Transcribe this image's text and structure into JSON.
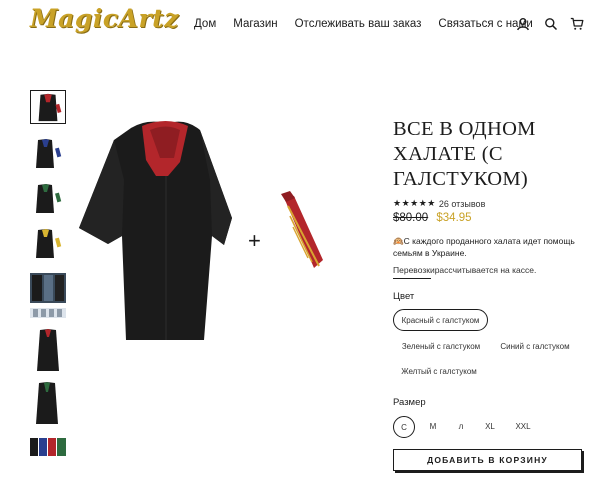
{
  "header": {
    "logo": "MagicArtz",
    "nav": [
      "Дом",
      "Магазин",
      "Отслеживать ваш заказ",
      "Связаться с нами"
    ],
    "icons": [
      "user-icon",
      "search-icon",
      "cart-icon"
    ]
  },
  "gallery": {
    "thumbnails": [
      "robe-red-tie",
      "robe-blue-tie",
      "robe-green-tie",
      "robe-yellow-tie",
      "robe-collage",
      "robe-strip",
      "robe-front",
      "robe-green",
      "robe-variants"
    ],
    "selected": 0
  },
  "product": {
    "title": "ВСЕ В ОДНОМ ХАЛАТЕ (С ГАЛСТУКОМ)",
    "stars": "★★★★★",
    "reviews": "26 отзывов",
    "old_price": "$80.00",
    "new_price": "$34.95",
    "notice_icon": "🙉",
    "notice": "С каждого проданного халата идет помощь семьям в Украине.",
    "tax_note": "Перевозкирассчитывается на кассе.",
    "plus": "+"
  },
  "color": {
    "label": "Цвет",
    "options": [
      "Красный с галстуком",
      "Зеленый с галстуком",
      "Синий с галстуком",
      "Желтый с галстуком"
    ],
    "selected": "Красный с галстуком"
  },
  "size": {
    "label": "Размер",
    "options": [
      "С",
      "М",
      "л",
      "XL",
      "XXL"
    ],
    "selected": "С"
  },
  "cart": {
    "label": "ДОБАВИТЬ В КОРЗИНУ"
  },
  "colors": {
    "gold": "#c9a227",
    "ink": "#1c1c1c",
    "robe": "#1b1b1b",
    "lining": "#b3262b"
  }
}
